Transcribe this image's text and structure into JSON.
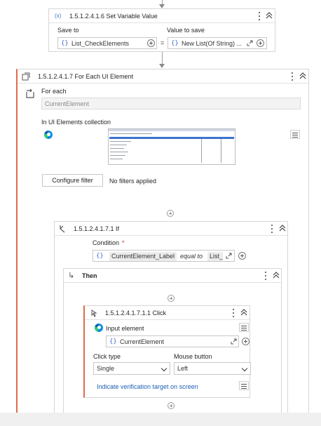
{
  "set_variable": {
    "title": "1.5.1.2.4.1.6 Set Variable Value",
    "icon": "(x)",
    "save_to_label": "Save to",
    "value_to_save_label": "Value to save",
    "save_to_value": "List_CheckElements",
    "value_to_save_value": "New List(Of String) ...",
    "equals": "="
  },
  "for_each": {
    "title": "1.5.1.2.4.1.7 For Each UI Element",
    "for_each_label": "For each",
    "item_placeholder": "CurrentElement",
    "collection_label": "In UI Elements collection",
    "configure_filter_label": "Configure filter",
    "filter_status": "No filters applied"
  },
  "if_block": {
    "title": "1.5.1.2.4.1.7.1 If",
    "condition_label": "Condition",
    "required_marker": "*",
    "condition_left": "CurrentElement_Label",
    "condition_op": "equal to",
    "condition_right": "List_C"
  },
  "then_block": {
    "title": "Then"
  },
  "click": {
    "title": "1.5.1.2.4.1.7.1.1 Click",
    "input_element_label": "Input element",
    "input_element_value": "CurrentElement",
    "click_type_label": "Click type",
    "click_type_value": "Single",
    "mouse_button_label": "Mouse button",
    "mouse_button_value": "Left",
    "indicate_link": "Indicate verification target on screen"
  },
  "glyphs": {
    "curly": "{}",
    "then_arrow": "↳"
  },
  "colors": {
    "accent": "#e06c4a",
    "link": "#1a5fb4",
    "variable": "#3f6fd0"
  }
}
